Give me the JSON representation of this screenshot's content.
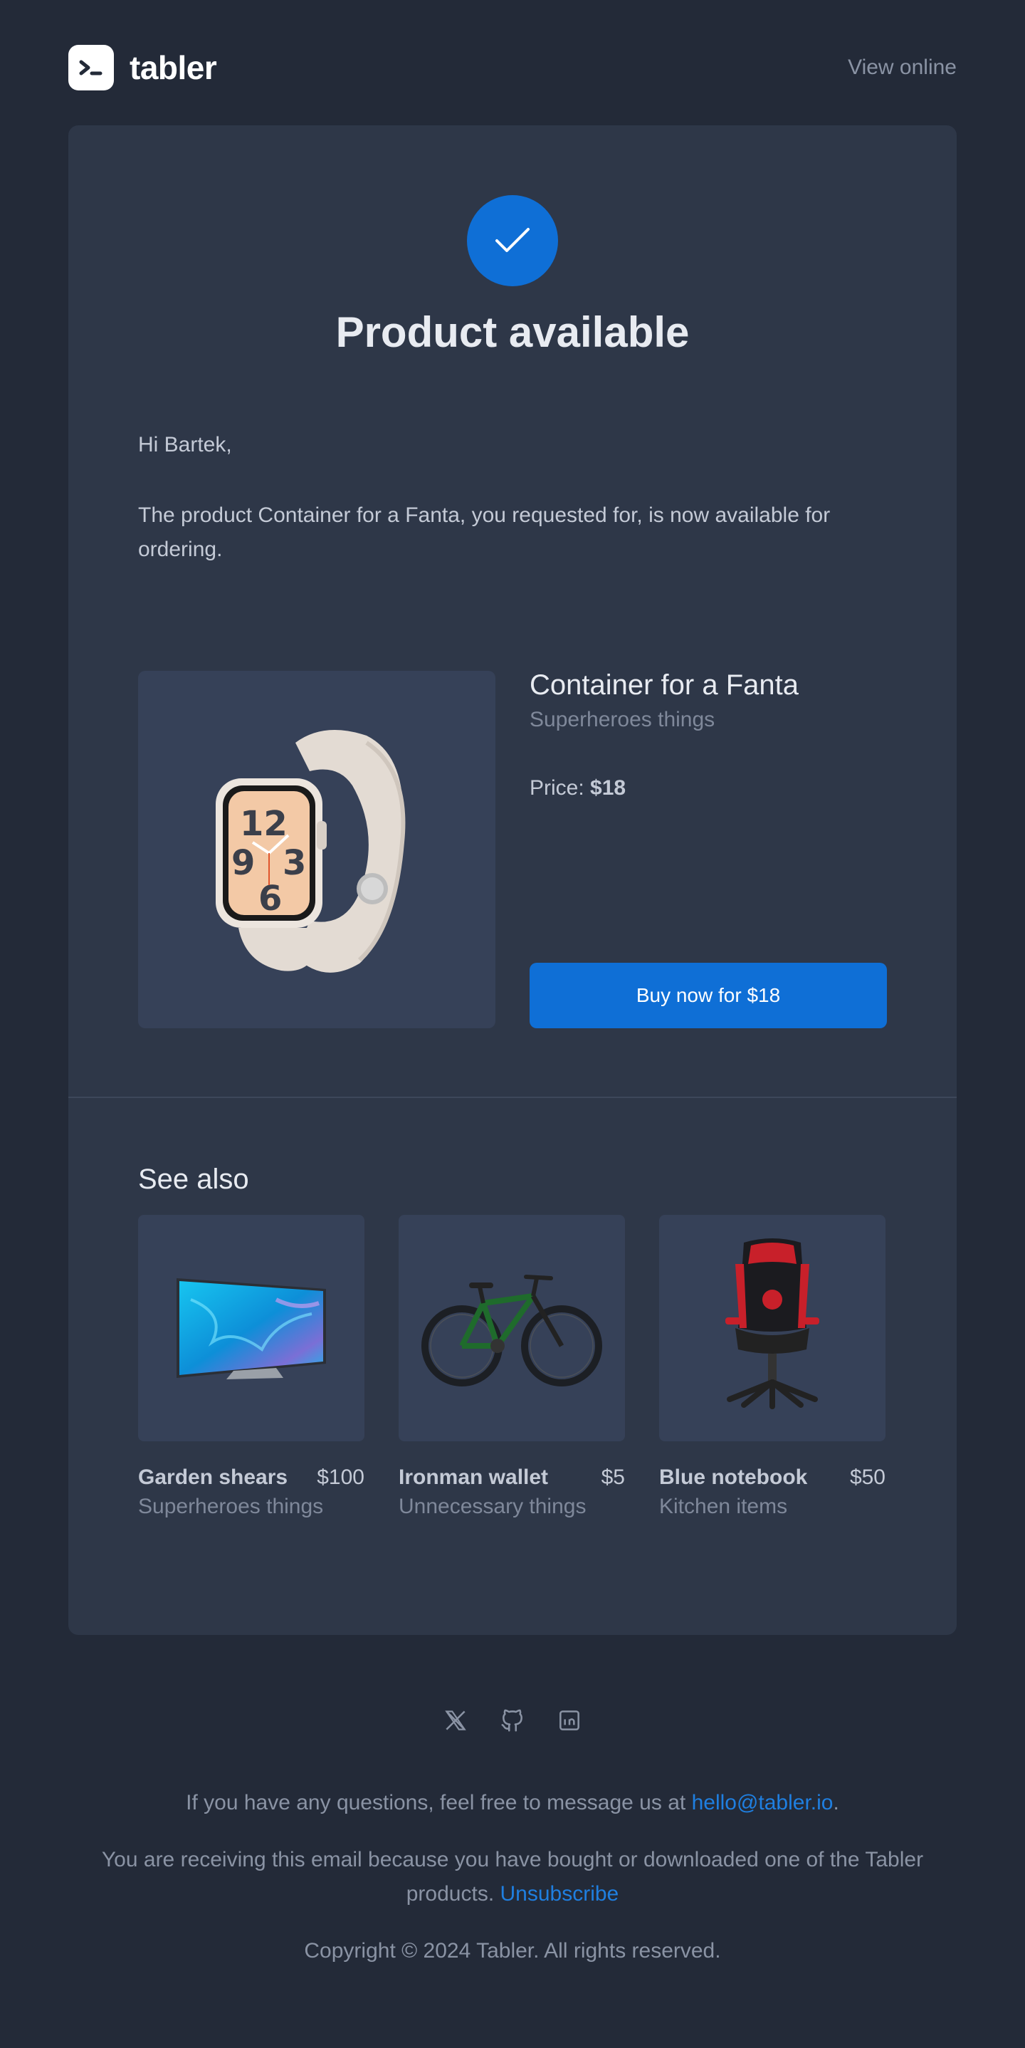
{
  "header": {
    "logo_text": "tabler",
    "view_online": "View online"
  },
  "hero": {
    "title": "Product available",
    "greeting": "Hi Bartek,",
    "message": "The product Container for a Fanta, you requested for, is now available for ordering."
  },
  "product": {
    "name": "Container for a Fanta",
    "category": "Superheroes things",
    "price_label": "Price:",
    "price_value": "$18",
    "buy_label": "Buy now for $18",
    "image_icon": "smartwatch-icon"
  },
  "see_also": {
    "title": "See also",
    "items": [
      {
        "name": "Garden shears",
        "price": "$100",
        "category": "Superheroes things",
        "image_icon": "tv-icon"
      },
      {
        "name": "Ironman wallet",
        "price": "$5",
        "category": "Unnecessary things",
        "image_icon": "bicycle-icon"
      },
      {
        "name": "Blue notebook",
        "price": "$50",
        "category": "Kitchen items",
        "image_icon": "gaming-chair-icon"
      }
    ]
  },
  "footer": {
    "socials": [
      "x-icon",
      "github-icon",
      "linkedin-icon"
    ],
    "contact_text": "If you have any questions, feel free to message us at",
    "contact_email": "hello@tabler.io",
    "contact_end": ".",
    "receiving_text": "You are receiving this email because you have bought or downloaded one of the Tabler products.",
    "unsubscribe": "Unsubscribe",
    "copyright": "Copyright © 2024 Tabler. All rights reserved."
  },
  "colors": {
    "background": "#232a38",
    "card": "#2e3748",
    "accent": "#0f6fd6",
    "link": "#1f7fe0"
  }
}
